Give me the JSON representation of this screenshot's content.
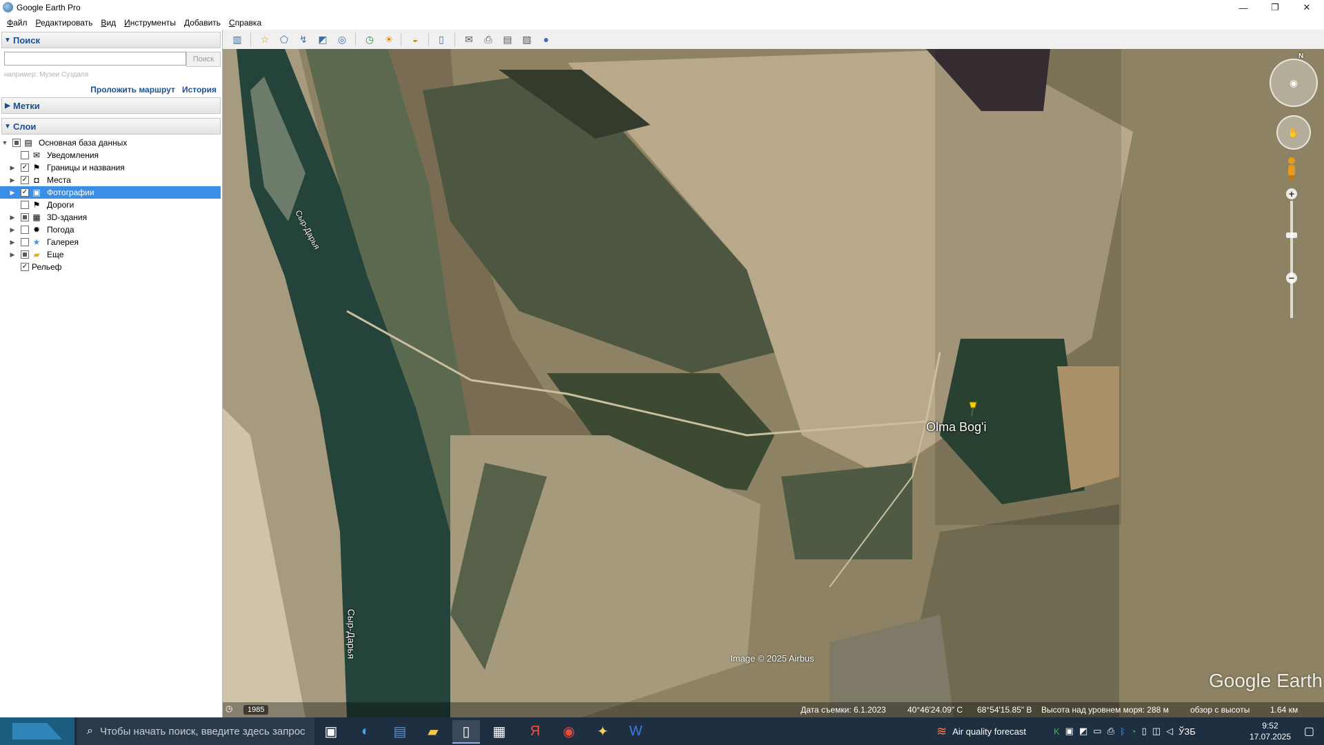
{
  "window": {
    "title": "Google Earth Pro",
    "controls": [
      "—",
      "❐",
      "✕"
    ]
  },
  "menu": [
    "Файл",
    "Редактировать",
    "Вид",
    "Инструменты",
    "Добавить",
    "Справка"
  ],
  "search": {
    "header": "Поиск",
    "input_value": "",
    "placeholder": "",
    "button": "Поиск",
    "hint": "например: Музеи Суздаля",
    "link_route": "Проложить маршрут",
    "link_history": "История"
  },
  "places": {
    "header": "Метки"
  },
  "layers": {
    "header": "Слои",
    "items": [
      {
        "label": "Основная база данных",
        "checkbox": "partial",
        "icon": "database-icon",
        "glyph": "▤",
        "expander": "▼"
      },
      {
        "label": "Уведомления",
        "checkbox": "unchecked",
        "icon": "envelope-icon",
        "glyph": "✉",
        "expander": ""
      },
      {
        "label": "Границы и названия",
        "checkbox": "checked",
        "icon": "flag-icon",
        "glyph": "⚑",
        "expander": "▶"
      },
      {
        "label": "Места",
        "checkbox": "checked",
        "icon": "places-icon",
        "glyph": "◘",
        "expander": "▶"
      },
      {
        "label": "Фотографии",
        "checkbox": "checked",
        "icon": "photo-icon",
        "glyph": "▣",
        "expander": "▶",
        "selected": true
      },
      {
        "label": "Дороги",
        "checkbox": "unchecked",
        "icon": "road-icon",
        "glyph": "⚑",
        "expander": ""
      },
      {
        "label": "3D-здания",
        "checkbox": "partial",
        "icon": "building-icon",
        "glyph": "▦",
        "expander": "▶"
      },
      {
        "label": "Погода",
        "checkbox": "unchecked",
        "icon": "weather-icon",
        "glyph": "✹",
        "expander": "▶"
      },
      {
        "label": "Галерея",
        "checkbox": "unchecked",
        "icon": "gallery-icon",
        "glyph": "★",
        "expander": "▶"
      },
      {
        "label": "Еще",
        "checkbox": "partial",
        "icon": "folder-icon",
        "glyph": "▰",
        "expander": "▶"
      },
      {
        "label": "Рельеф",
        "checkbox": "checked",
        "icon": "",
        "glyph": "",
        "expander": ""
      }
    ]
  },
  "toolbar": {
    "buttons": [
      {
        "name": "sidebar-toggle-icon",
        "glyph": "▥"
      },
      {
        "name": "add-placemark-icon",
        "glyph": "☆"
      },
      {
        "name": "add-polygon-icon",
        "glyph": "⬠"
      },
      {
        "name": "add-path-icon",
        "glyph": "↯"
      },
      {
        "name": "add-overlay-icon",
        "glyph": "◩"
      },
      {
        "name": "record-tour-icon",
        "glyph": "◎"
      },
      {
        "name": "historical-imagery-icon",
        "glyph": "◷"
      },
      {
        "name": "sunlight-icon",
        "glyph": "☀"
      },
      {
        "name": "planets-icon",
        "glyph": "◒"
      },
      {
        "name": "ruler-icon",
        "glyph": "▯"
      },
      {
        "name": "email-icon",
        "glyph": "✉"
      },
      {
        "name": "print-icon",
        "glyph": "⎙"
      },
      {
        "name": "save-image-icon",
        "glyph": "▤"
      },
      {
        "name": "view-in-maps-icon",
        "glyph": "▨"
      },
      {
        "name": "earth-gallery-icon",
        "glyph": "●"
      }
    ]
  },
  "map": {
    "labels": {
      "river_top": "Сыр-Дарья",
      "river_bottom": "Сыр-Дарья",
      "placemark": "Olma Bog'i"
    },
    "credit": "Image © 2025 Airbus",
    "logo": "Google Earth",
    "north": "N",
    "status": {
      "year": "1985",
      "date": "Дата съемки: 6.1.2023",
      "lat": "40°46'24.09\" С",
      "lon": "68°54'15.85\" В",
      "elev": "Высота над уровнем моря: 288 м",
      "eye": "обзор с высоты",
      "eye_value": "1.64 км"
    }
  },
  "taskbar": {
    "search_text": "Чтобы начать поиск, введите здесь запрос",
    "air_quality": "Air quality forecast",
    "lang": "ЎЗБ",
    "time": "9:52",
    "date": "17.07.2025"
  },
  "colors": {
    "accent": "#3a8ee6",
    "link": "#1a4f8f",
    "taskbar": "#1f2f42"
  }
}
